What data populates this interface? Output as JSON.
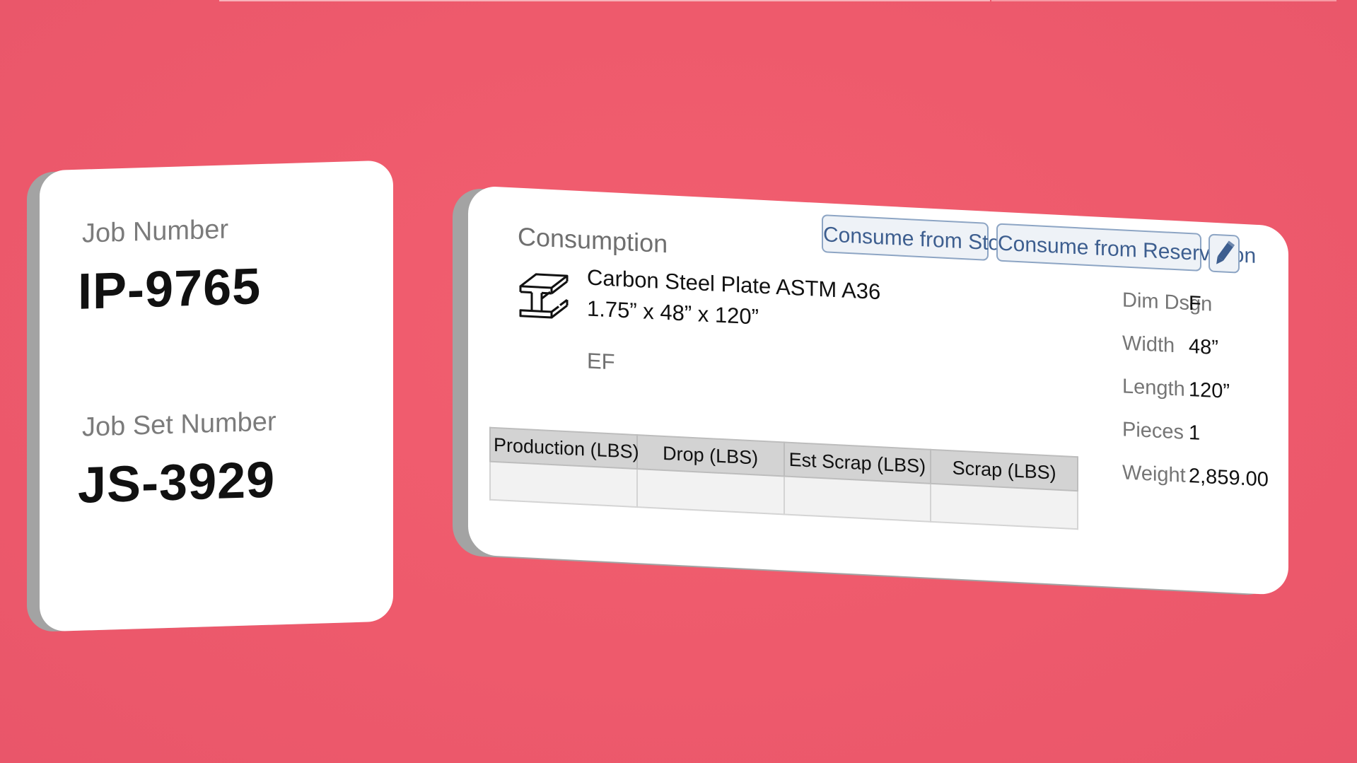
{
  "job": {
    "number_label": "Job Number",
    "number_value": "IP-9765",
    "set_label": "Job Set Number",
    "set_value": "JS-3929"
  },
  "consumption": {
    "title": "Consumption",
    "buttons": {
      "stock": "Consume from Stock",
      "reservation": "Consume from Reservation",
      "edit_icon": "pencil-icon"
    },
    "material": {
      "icon": "i-beam-icon",
      "name": "Carbon Steel Plate ASTM A36",
      "dimensions": "1.75” x 48” x 120”",
      "code": "EF"
    },
    "table": {
      "headers": [
        "Production (LBS)",
        "Drop (LBS)",
        "Est Scrap (LBS)",
        "Scrap (LBS)"
      ],
      "values": [
        "",
        "",
        "",
        ""
      ]
    },
    "specs": [
      {
        "label": "Dim Dsgn",
        "value": "F"
      },
      {
        "label": "Width",
        "value": "48”"
      },
      {
        "label": "Length",
        "value": "120”"
      },
      {
        "label": "Pieces",
        "value": "1"
      },
      {
        "label": "Weight",
        "value": "2,859.00"
      }
    ]
  },
  "colors": {
    "background": "#ee5a6c",
    "card": "#ffffff",
    "card_depth": "#a3a3a3",
    "button_text": "#3d5e8f",
    "button_border": "#8da5c4",
    "table_header": "#d3d3d3"
  }
}
